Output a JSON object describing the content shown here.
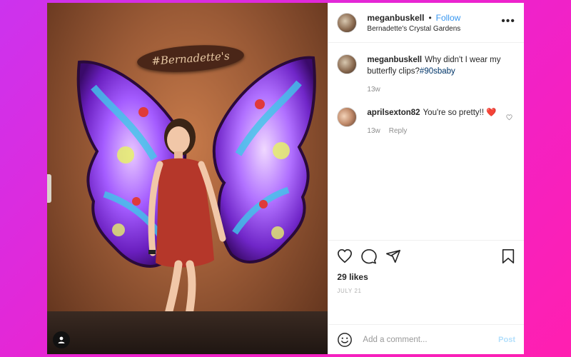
{
  "photo": {
    "sign_text": "#Bernadette's"
  },
  "header": {
    "username": "meganbuskell",
    "separator": "•",
    "follow_label": "Follow",
    "location": "Bernadette's Crystal Gardens",
    "more_icon": "more-horizontal-icon"
  },
  "comments": [
    {
      "username": "meganbuskell",
      "text": "Why didn't I wear my butterfly clips?",
      "hashtag": "#90sbaby",
      "time": "13w"
    },
    {
      "username": "aprilsexton82",
      "text": "You're so pretty!! ❤️",
      "time": "13w",
      "reply_label": "Reply"
    }
  ],
  "actions": {
    "likes": "29 likes",
    "date": "JULY 21"
  },
  "add_comment": {
    "placeholder": "Add a comment...",
    "post_label": "Post"
  },
  "colors": {
    "background_start": "#cc33ee",
    "background_end": "#ff1fb0",
    "link_blue": "#3897f0",
    "text": "#262626",
    "muted": "#8e8e8e"
  }
}
